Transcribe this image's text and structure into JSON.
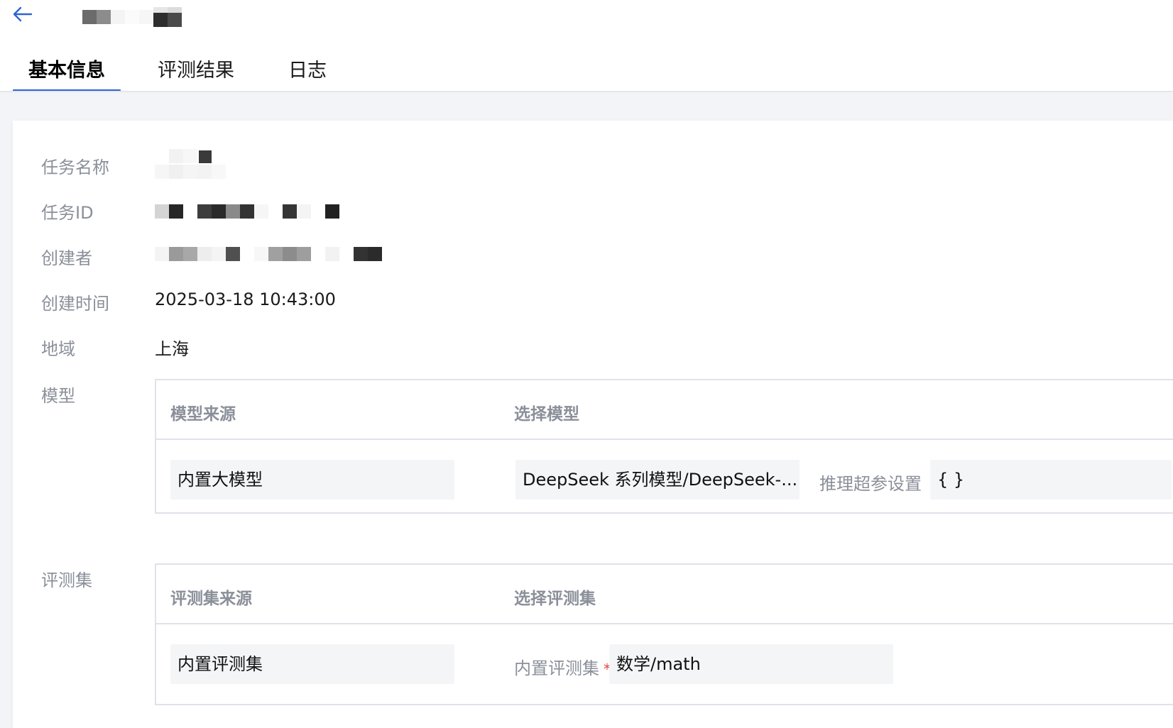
{
  "header": {
    "back_icon": "arrow-left-icon",
    "accent_color": "#2f62d6"
  },
  "tabs": [
    {
      "label": "基本信息",
      "active": true
    },
    {
      "label": "评测结果",
      "active": false
    },
    {
      "label": "日志",
      "active": false
    }
  ],
  "basic_info": {
    "task_name_label": "任务名称",
    "task_id_label": "任务ID",
    "creator_label": "创建者",
    "created_time_label": "创建时间",
    "created_time_value": "2025-03-18 10:43:00",
    "region_label": "地域",
    "region_value": "上海",
    "model_label": "模型",
    "dataset_label": "评测集"
  },
  "model_panel": {
    "source_header": "模型来源",
    "select_header": "选择模型",
    "source_value": "内置大模型",
    "model_value": "DeepSeek 系列模型/DeepSeek-...",
    "hyper_label": "推理超参设置",
    "hyper_value": "{ }"
  },
  "dataset_panel": {
    "source_header": "评测集来源",
    "select_header": "选择评测集",
    "source_value": "内置评测集",
    "builtin_label": "内置评测集",
    "required_mark": "*",
    "dataset_value": "数学/math"
  }
}
